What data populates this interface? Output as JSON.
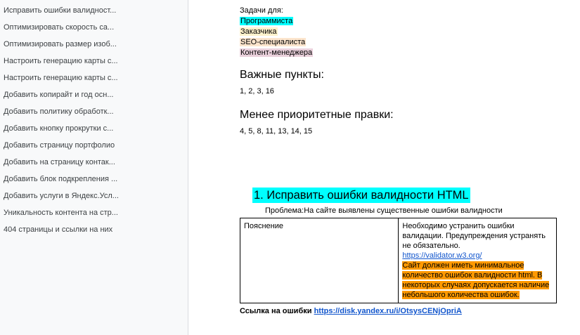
{
  "outline": {
    "items": [
      "Исправить ошибки валидност...",
      "Оптимизировать скорость са...",
      "Оптимизировать размер изоб...",
      "Настроить генерацию карты с...",
      "Настроить генерацию карты с...",
      "Добавить копирайт и год осн...",
      "Добавить политику обработк...",
      "Добавить кнопку прокрутки с...",
      "Добавить страницу портфолио",
      "Добавить на страницу контак...",
      "Добавить блок подкрепления ...",
      "Добавить услуги в Яндекс.Усл...",
      "Уникальность контента на стр...",
      "404 страницы и ссылки на них"
    ]
  },
  "doc": {
    "tasks_for": "Задачи для:",
    "roles": {
      "programmer": "Программиста",
      "client": "Заказчика",
      "seo": "SEO-специалиста",
      "content": "Контент-менеджера"
    },
    "important_title": "Важные пункты:",
    "important_items": "1, 2, 3, 16",
    "less_priority_title": "Менее приоритетные правки:",
    "less_priority_items": "4, 5, 8, 11, 13, 14, 15",
    "section1_title": "1. Исправить ошибки валидности HTML",
    "problem": "Проблема:На сайте выявлены существенные ошибки валидности",
    "table": {
      "col1": "Пояснение",
      "col2_text": "Необходимо устранить ошибки валидации. Предупреждения устранять не обязательно.",
      "col2_link": "https://validator.w3.org/",
      "col2_note": "Сайт должен иметь минимальное количество ошибок валидности html. В некоторых случаях допускается наличие небольшого количества ошибок."
    },
    "errors_label": "Ссылка на ошибки",
    "errors_link": "https://disk.yandex.ru/i/OtsysCENjOpriA"
  },
  "colors": {
    "cyan_highlight": "#00ffff",
    "yellow_highlight": "#fff2cc",
    "orange_highlight": "#ff9900",
    "pink_highlight": "#ead1dc",
    "link": "#1155cc"
  }
}
